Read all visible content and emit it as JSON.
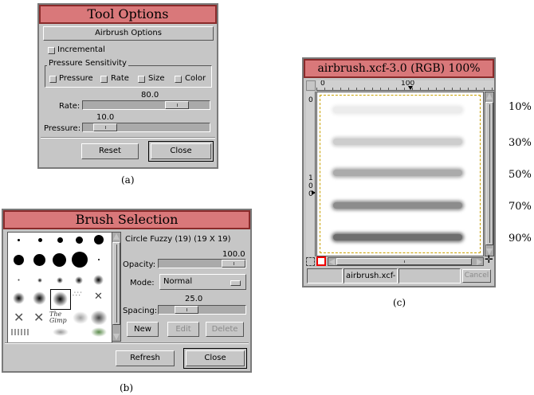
{
  "tool_options": {
    "title": "Tool Options",
    "section_button": "Airbrush Options",
    "incremental_label": "Incremental",
    "pressure_group_label": "Pressure Sensitivity",
    "pressure_checks": [
      "Pressure",
      "Rate",
      "Size",
      "Color"
    ],
    "rate_value": "80.0",
    "rate_label": "Rate:",
    "rate_level": 80,
    "pressure_value": "10.0",
    "pressure_label": "Pressure:",
    "pressure_level": 10,
    "reset_label": "Reset",
    "close_label": "Close",
    "caption": "(a)"
  },
  "brush_selection": {
    "title": "Brush Selection",
    "brush_name": "Circle Fuzzy (19)  (19 X 19)",
    "opacity_label": "Opacity:",
    "opacity_value": "100.0",
    "opacity_level": 100,
    "mode_label": "Mode:",
    "mode_value": "Normal",
    "spacing_value": "25.0",
    "spacing_label": "Spacing:",
    "spacing_level": 25,
    "new_label": "New",
    "edit_label": "Edit",
    "delete_label": "Delete",
    "refresh_label": "Refresh",
    "close_label": "Close",
    "gimp_brush_text": "The Gimp",
    "caption": "(b)"
  },
  "image_window": {
    "title": "airbrush.xcf-3.0 (RGB) 100%",
    "ruler_top": [
      "0",
      "100"
    ],
    "ruler_left": [
      "0",
      "100"
    ],
    "status_text": "airbrush.xcf-",
    "cancel_label": "Cancel",
    "caption": "(c)",
    "pressure_labels": [
      "10%",
      "30%",
      "50%",
      "70%",
      "90%"
    ],
    "stroke_colors": [
      "#ececec",
      "#cdcdcd",
      "#ababab",
      "#8c8c8c",
      "#6e6e6e"
    ]
  },
  "colors": {
    "title_bar": "#d9787a",
    "window_bg": "#c6c6c6"
  }
}
